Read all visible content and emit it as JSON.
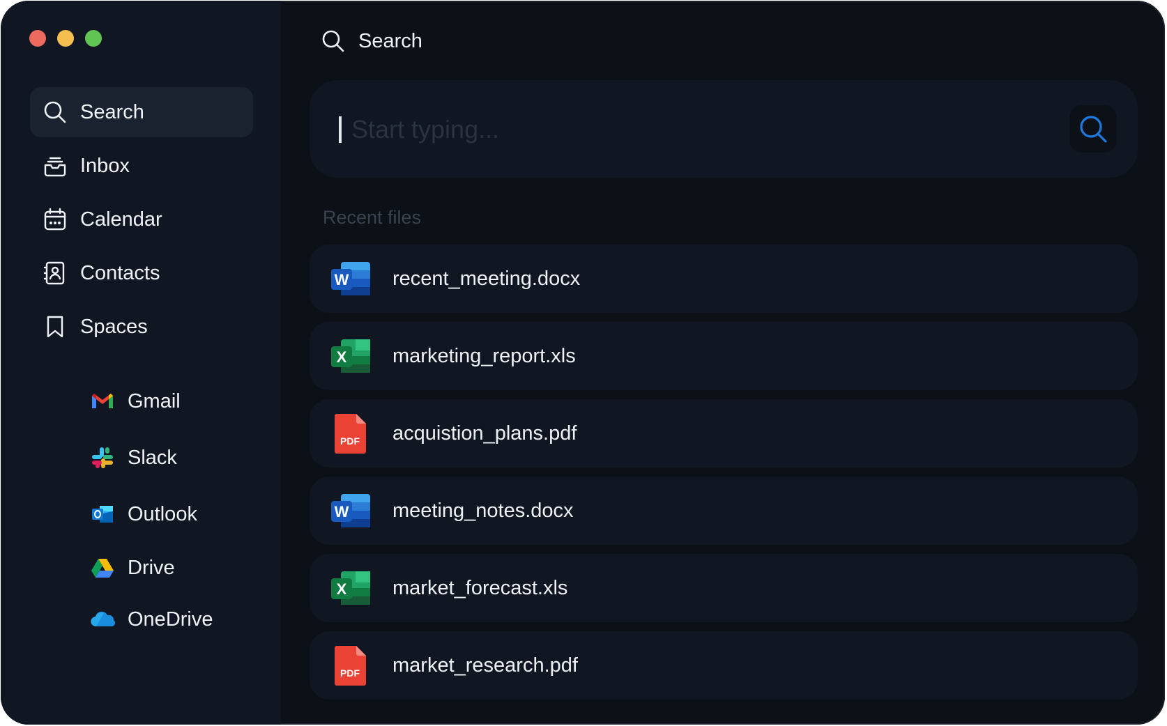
{
  "sidebar": {
    "nav": [
      {
        "label": "Search",
        "icon": "search-icon",
        "active": true
      },
      {
        "label": "Inbox",
        "icon": "inbox-icon"
      },
      {
        "label": "Calendar",
        "icon": "calendar-icon"
      },
      {
        "label": "Contacts",
        "icon": "contacts-icon"
      },
      {
        "label": "Spaces",
        "icon": "bookmark-icon"
      }
    ],
    "spaces": [
      {
        "label": "Gmail",
        "icon": "gmail-icon"
      },
      {
        "label": "Slack",
        "icon": "slack-icon"
      },
      {
        "label": "Outlook",
        "icon": "outlook-icon"
      },
      {
        "label": "Drive",
        "icon": "google-drive-icon"
      },
      {
        "label": "OneDrive",
        "icon": "onedrive-icon"
      }
    ]
  },
  "main": {
    "title": "Search",
    "search": {
      "placeholder": "Start typing...",
      "value": ""
    },
    "recent_label": "Recent files",
    "files": [
      {
        "name": "recent_meeting.docx",
        "icon": "word-file-icon"
      },
      {
        "name": "marketing_report.xls",
        "icon": "excel-file-icon"
      },
      {
        "name": "acquistion_plans.pdf",
        "icon": "pdf-file-icon"
      },
      {
        "name": "meeting_notes.docx",
        "icon": "word-file-icon"
      },
      {
        "name": "market_forecast.xls",
        "icon": "excel-file-icon"
      },
      {
        "name": "market_research.pdf",
        "icon": "pdf-file-icon"
      }
    ]
  },
  "colors": {
    "background": "#0b1117",
    "sidebar": "#111722",
    "accent": "#1f7ae0",
    "traffic_red": "#ed6a5e",
    "traffic_yellow": "#f5bf4f",
    "traffic_green": "#61c554"
  }
}
